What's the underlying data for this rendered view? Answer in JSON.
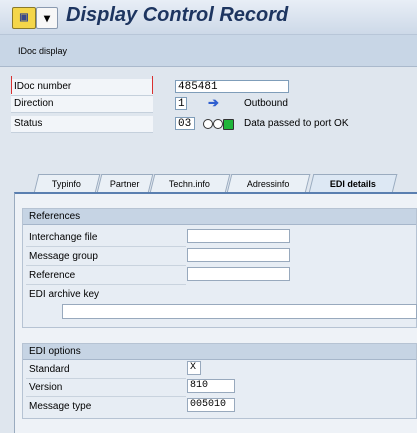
{
  "title": "Display Control Record",
  "toolbar": {
    "idoc_display_label": "IDoc display"
  },
  "header": {
    "idoc_number": {
      "label": "IDoc number",
      "value": "485481"
    },
    "direction": {
      "label": "Direction",
      "value": "1",
      "text": "Outbound",
      "icon": "arrow-right-icon"
    },
    "status": {
      "label": "Status",
      "value": "03",
      "text": "Data passed to port OK",
      "icon": "traffic-light-icon"
    }
  },
  "tabs": [
    {
      "label": "Typinfo",
      "active": false
    },
    {
      "label": "Partner",
      "active": false
    },
    {
      "label": "Techn.info",
      "active": false
    },
    {
      "label": "Adressinfo",
      "active": false
    },
    {
      "label": "EDI details",
      "active": true
    }
  ],
  "references": {
    "title": "References",
    "interchange_file": {
      "label": "Interchange file",
      "value": ""
    },
    "message_group": {
      "label": "Message group",
      "value": ""
    },
    "reference": {
      "label": "Reference",
      "value": ""
    },
    "edi_archive_key": {
      "label": "EDI archive key",
      "value": ""
    }
  },
  "edi_options": {
    "title": "EDI options",
    "standard": {
      "label": "Standard",
      "value": "X"
    },
    "version": {
      "label": "Version",
      "value": "810"
    },
    "message_type": {
      "label": "Message type",
      "value": "005010"
    }
  },
  "colors": {
    "title": "#1d3560",
    "arrow": "#2f5fd0",
    "light_green": "#1fb53a"
  }
}
